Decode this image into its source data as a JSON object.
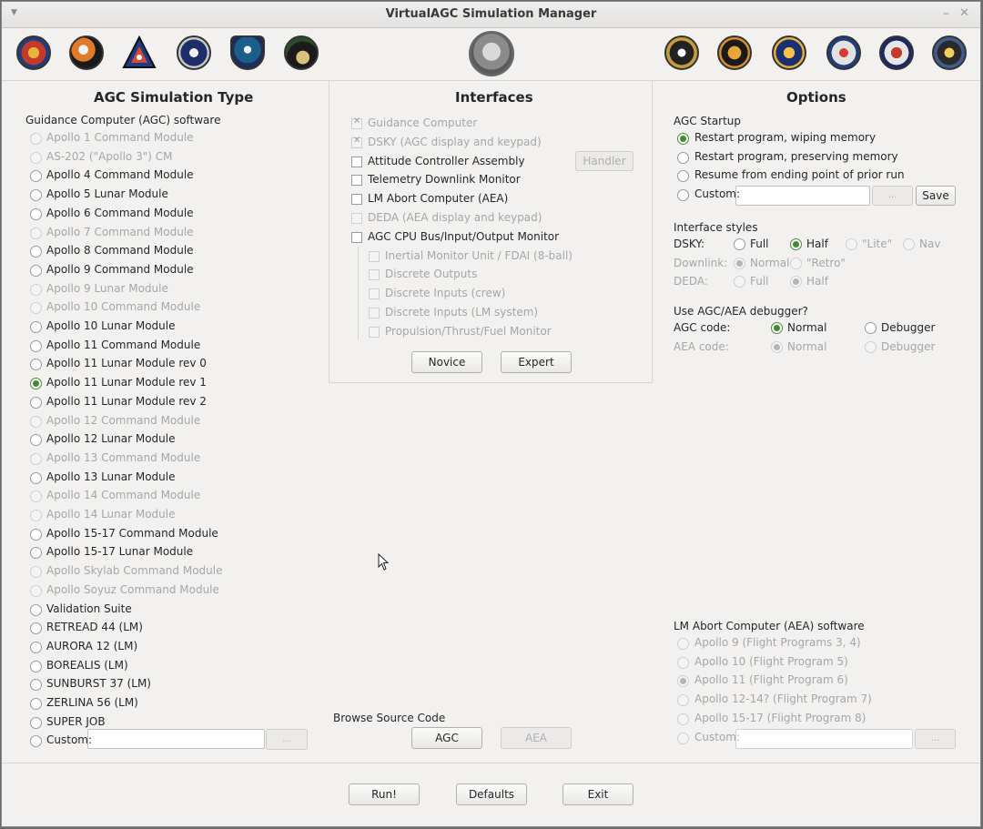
{
  "window": {
    "title": "VirtualAGC Simulation Manager"
  },
  "colors": {
    "accent": "#3f8c2e",
    "disabled_text": "#a6a6a6",
    "window_bg": "#f2f1f0"
  },
  "patches": [
    "apollo-7-patch",
    "apollo-8-patch",
    "apollo-1-patch",
    "apollo-9-patch",
    "apollo-10-patch",
    "apollo-11-patch",
    "apollo-emblem",
    "apollo-12-patch",
    "apollo-13-patch",
    "apollo-14-patch",
    "apollo-15-patch",
    "apollo-16-patch",
    "apollo-17-patch"
  ],
  "left": {
    "heading": "AGC Simulation Type",
    "group_label": "Guidance Computer (AGC) software",
    "items": [
      {
        "label": "Apollo 1 Command Module",
        "enabled": false,
        "selected": false
      },
      {
        "label": "AS-202 (\"Apollo 3\") CM",
        "enabled": false,
        "selected": false
      },
      {
        "label": "Apollo 4 Command Module",
        "enabled": true,
        "selected": false
      },
      {
        "label": "Apollo 5 Lunar Module",
        "enabled": true,
        "selected": false
      },
      {
        "label": "Apollo 6 Command Module",
        "enabled": true,
        "selected": false
      },
      {
        "label": "Apollo 7 Command Module",
        "enabled": false,
        "selected": false
      },
      {
        "label": "Apollo 8 Command Module",
        "enabled": true,
        "selected": false
      },
      {
        "label": "Apollo 9 Command Module",
        "enabled": true,
        "selected": false
      },
      {
        "label": "Apollo 9 Lunar Module",
        "enabled": false,
        "selected": false
      },
      {
        "label": "Apollo 10 Command Module",
        "enabled": false,
        "selected": false
      },
      {
        "label": "Apollo 10 Lunar Module",
        "enabled": true,
        "selected": false
      },
      {
        "label": "Apollo 11 Command Module",
        "enabled": true,
        "selected": false
      },
      {
        "label": "Apollo 11 Lunar Module rev 0",
        "enabled": true,
        "selected": false
      },
      {
        "label": "Apollo 11 Lunar Module rev 1",
        "enabled": true,
        "selected": true
      },
      {
        "label": "Apollo 11 Lunar Module rev 2",
        "enabled": true,
        "selected": false
      },
      {
        "label": "Apollo 12 Command Module",
        "enabled": false,
        "selected": false
      },
      {
        "label": "Apollo 12 Lunar Module",
        "enabled": true,
        "selected": false
      },
      {
        "label": "Apollo 13 Command Module",
        "enabled": false,
        "selected": false
      },
      {
        "label": "Apollo 13 Lunar Module",
        "enabled": true,
        "selected": false
      },
      {
        "label": "Apollo 14 Command Module",
        "enabled": false,
        "selected": false
      },
      {
        "label": "Apollo 14 Lunar Module",
        "enabled": false,
        "selected": false
      },
      {
        "label": "Apollo 15-17 Command Module",
        "enabled": true,
        "selected": false
      },
      {
        "label": "Apollo 15-17 Lunar Module",
        "enabled": true,
        "selected": false
      },
      {
        "label": "Apollo Skylab Command Module",
        "enabled": false,
        "selected": false
      },
      {
        "label": "Apollo Soyuz Command Module",
        "enabled": false,
        "selected": false
      },
      {
        "label": "Validation Suite",
        "enabled": true,
        "selected": false
      },
      {
        "label": "RETREAD 44 (LM)",
        "enabled": true,
        "selected": false
      },
      {
        "label": "AURORA 12 (LM)",
        "enabled": true,
        "selected": false
      },
      {
        "label": "BOREALIS (LM)",
        "enabled": true,
        "selected": false
      },
      {
        "label": "SUNBURST 37 (LM)",
        "enabled": true,
        "selected": false
      },
      {
        "label": "ZERLINA 56 (LM)",
        "enabled": true,
        "selected": false
      },
      {
        "label": "SUPER JOB",
        "enabled": true,
        "selected": false
      },
      {
        "label": "Custom:",
        "enabled": true,
        "selected": false
      }
    ],
    "custom_browse": "..."
  },
  "middle": {
    "heading": "Interfaces",
    "items": [
      {
        "label": "Guidance Computer",
        "enabled": false,
        "checked": true,
        "indent": false
      },
      {
        "label": "DSKY (AGC display and keypad)",
        "enabled": false,
        "checked": true,
        "indent": false
      },
      {
        "label": "Attitude Controller Assembly",
        "enabled": true,
        "checked": false,
        "indent": false
      },
      {
        "label": "Telemetry Downlink Monitor",
        "enabled": true,
        "checked": false,
        "indent": false
      },
      {
        "label": "LM Abort Computer (AEA)",
        "enabled": true,
        "checked": false,
        "indent": false
      },
      {
        "label": "DEDA (AEA display and keypad)",
        "enabled": false,
        "checked": false,
        "indent": false
      },
      {
        "label": "AGC CPU Bus/Input/Output Monitor",
        "enabled": true,
        "checked": false,
        "indent": false
      },
      {
        "label": "Inertial Monitor Unit / FDAI (8-ball)",
        "enabled": false,
        "checked": false,
        "indent": true
      },
      {
        "label": "Discrete Outputs",
        "enabled": false,
        "checked": false,
        "indent": true
      },
      {
        "label": "Discrete Inputs (crew)",
        "enabled": false,
        "checked": false,
        "indent": true
      },
      {
        "label": "Discrete Inputs (LM system)",
        "enabled": false,
        "checked": false,
        "indent": true
      },
      {
        "label": "Propulsion/Thrust/Fuel Monitor",
        "enabled": false,
        "checked": false,
        "indent": true
      }
    ],
    "handler_label": "Handler",
    "novice_label": "Novice",
    "expert_label": "Expert",
    "browse_label": "Browse Source Code",
    "agc_label": "AGC",
    "aea_label": "AEA"
  },
  "right": {
    "heading": "Options",
    "startup_label": "AGC Startup",
    "startup": [
      {
        "label": "Restart program, wiping memory",
        "selected": true
      },
      {
        "label": "Restart program, preserving memory",
        "selected": false
      },
      {
        "label": "Resume from ending point of prior run",
        "selected": false
      },
      {
        "label": "Custom:",
        "selected": false
      }
    ],
    "custom_browse": "...",
    "save_label": "Save",
    "styles_label": "Interface styles",
    "dsky_label": "DSKY:",
    "dsky_opts": [
      "Full",
      "Half",
      "\"Lite\"",
      "Nav"
    ],
    "downlink_label": "Downlink:",
    "downlink_opts": [
      "Normal",
      "\"Retro\""
    ],
    "deda_label": "DEDA:",
    "deda_opts": [
      "Full",
      "Half"
    ],
    "debug_label": "Use AGC/AEA debugger?",
    "agc_code_label": "AGC code:",
    "aea_code_label": "AEA code:",
    "normal": "Normal",
    "debugger": "Debugger",
    "aea_sw_label": "LM Abort Computer (AEA) software",
    "aea_sw": [
      {
        "label": "Apollo 9 (Flight Programs 3, 4)",
        "selected": false
      },
      {
        "label": "Apollo 10 (Flight Program 5)",
        "selected": false
      },
      {
        "label": "Apollo 11 (Flight Program 6)",
        "selected": true
      },
      {
        "label": "Apollo 12-14? (Flight Program 7)",
        "selected": false
      },
      {
        "label": "Apollo 15-17 (Flight Program 8)",
        "selected": false
      },
      {
        "label": "Custom:",
        "selected": false
      }
    ]
  },
  "bottom": {
    "run_label": "Run!",
    "defaults_label": "Defaults",
    "exit_label": "Exit"
  }
}
